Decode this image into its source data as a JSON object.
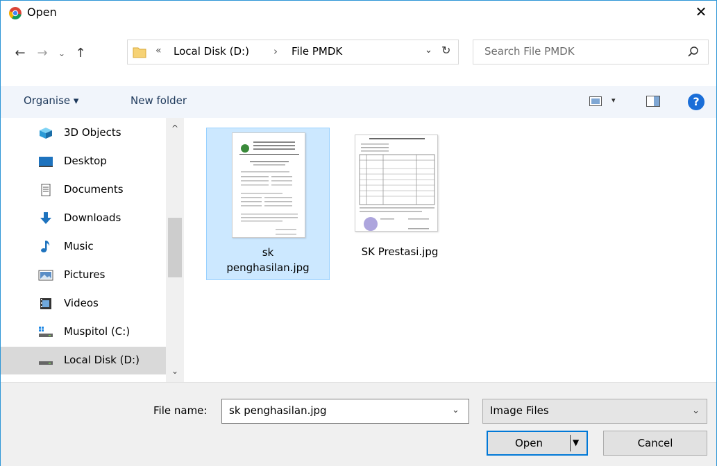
{
  "window": {
    "title": "Open",
    "close_glyph": "✕",
    "app_icon": "chrome-icon"
  },
  "nav": {
    "back": "←",
    "forward": "→",
    "recent": "⌄",
    "up": "↑"
  },
  "address": {
    "overflow": "«",
    "crumbs": [
      "Local Disk (D:)",
      "File PMDK"
    ],
    "separator": "›",
    "dropdown": "⌄",
    "refresh": "↻"
  },
  "search": {
    "placeholder": "Search File PMDK"
  },
  "toolbar": {
    "organise": "Organise ▾",
    "new_folder": "New folder",
    "view_drop": "▾",
    "help": "?"
  },
  "sidebar": {
    "items": [
      {
        "label": "3D Objects",
        "icon": "3d-objects-icon"
      },
      {
        "label": "Desktop",
        "icon": "desktop-icon"
      },
      {
        "label": "Documents",
        "icon": "documents-icon"
      },
      {
        "label": "Downloads",
        "icon": "downloads-icon"
      },
      {
        "label": "Music",
        "icon": "music-icon"
      },
      {
        "label": "Pictures",
        "icon": "pictures-icon"
      },
      {
        "label": "Videos",
        "icon": "videos-icon"
      },
      {
        "label": "Muspitol (C:)",
        "icon": "drive-icon"
      },
      {
        "label": "Local Disk (D:)",
        "icon": "drive-icon",
        "selected": true
      }
    ],
    "scroll_up": "^",
    "scroll_down": "⌄"
  },
  "files": [
    {
      "name_line1": "sk",
      "name_line2": "penghasilan.jpg",
      "selected": true
    },
    {
      "name_line1": "SK Prestasi.jpg",
      "name_line2": "",
      "selected": false
    }
  ],
  "footer": {
    "file_name_label": "File name:",
    "file_name_value": "sk penghasilan.jpg",
    "dropdown": "⌄",
    "file_type": "Image Files",
    "open_label": "Open",
    "open_drop": "▼",
    "cancel_label": "Cancel"
  },
  "colors": {
    "accent": "#0078d7",
    "selection": "#cce8ff",
    "command_bar": "#f1f5fb",
    "help": "#1a6ed8"
  }
}
